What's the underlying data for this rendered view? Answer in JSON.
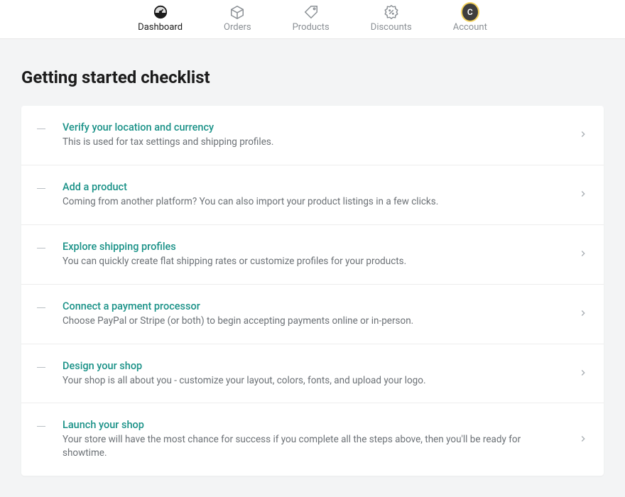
{
  "nav": {
    "items": [
      {
        "label": "Dashboard",
        "active": true
      },
      {
        "label": "Orders",
        "active": false
      },
      {
        "label": "Products",
        "active": false
      },
      {
        "label": "Discounts",
        "active": false
      },
      {
        "label": "Account",
        "active": false
      }
    ],
    "avatar_initial": "C"
  },
  "page_title": "Getting started checklist",
  "checklist": [
    {
      "title": "Verify your location and currency",
      "desc": "This is used for tax settings and shipping profiles."
    },
    {
      "title": "Add a product",
      "desc": "Coming from another platform? You can also import your product listings in a few clicks."
    },
    {
      "title": "Explore shipping profiles",
      "desc": "You can quickly create flat shipping rates or customize profiles for your products."
    },
    {
      "title": "Connect a payment processor",
      "desc": "Choose PayPal or Stripe (or both) to begin accepting payments online or in-person."
    },
    {
      "title": "Design your shop",
      "desc": "Your shop is all about you - customize your layout, colors, fonts, and upload your logo."
    },
    {
      "title": "Launch your shop",
      "desc": "Your store will have the most chance for success if you complete all the steps above, then you'll be ready for showtime."
    }
  ]
}
